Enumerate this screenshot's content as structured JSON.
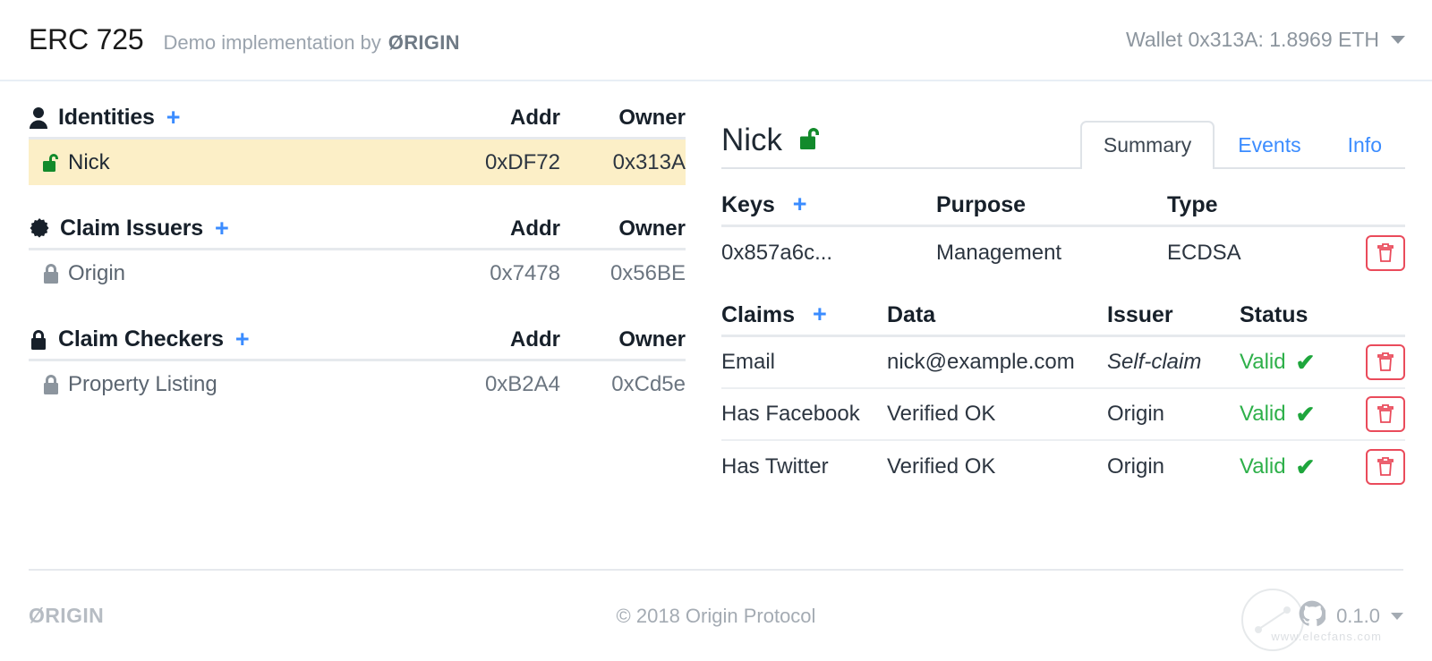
{
  "header": {
    "app_title": "ERC 725",
    "subtitle_prefix": "Demo implementation by",
    "subtitle_brand": "ØRIGIN",
    "wallet_label": "Wallet 0x313A: 1.8969 ETH",
    "caret_icon": "chevron-down-icon"
  },
  "sidebar": {
    "sections": [
      {
        "icon": "person-icon",
        "title": "Identities",
        "add_label": "+",
        "col_addr": "Addr",
        "col_owner": "Owner",
        "rows": [
          {
            "icon": "unlock-icon-green",
            "name": "Nick",
            "addr": "0xDF72",
            "owner": "0x313A",
            "selected": true
          }
        ]
      },
      {
        "icon": "certificate-icon",
        "title": "Claim Issuers",
        "add_label": "+",
        "col_addr": "Addr",
        "col_owner": "Owner",
        "rows": [
          {
            "icon": "lock-icon-gray",
            "name": "Origin",
            "addr": "0x7478",
            "owner": "0x56BE",
            "selected": false
          }
        ]
      },
      {
        "icon": "lock-icon-black",
        "title": "Claim Checkers",
        "add_label": "+",
        "col_addr": "Addr",
        "col_owner": "Owner",
        "rows": [
          {
            "icon": "lock-icon-gray",
            "name": "Property Listing",
            "addr": "0xB2A4",
            "owner": "0xCd5e",
            "selected": false
          }
        ]
      }
    ]
  },
  "detail": {
    "title": "Nick",
    "status_icon": "unlock-icon-green",
    "tabs": [
      {
        "label": "Summary",
        "active": true
      },
      {
        "label": "Events",
        "active": false
      },
      {
        "label": "Info",
        "active": false
      }
    ],
    "keys_table": {
      "title": "Keys",
      "add_label": "+",
      "headers": [
        "Purpose",
        "Type"
      ],
      "rows": [
        {
          "key": "0x857a6c...",
          "purpose": "Management",
          "type": "ECDSA",
          "delete_icon": "trash-icon"
        }
      ]
    },
    "claims_table": {
      "title": "Claims",
      "add_label": "+",
      "headers": [
        "Data",
        "Issuer",
        "Status"
      ],
      "rows": [
        {
          "claim": "Email",
          "data": "nick@example.com",
          "issuer": "Self-claim",
          "issuer_italic": true,
          "status": "Valid",
          "status_icon": "check-icon",
          "delete_icon": "trash-icon"
        },
        {
          "claim": "Has Facebook",
          "data": "Verified OK",
          "issuer": "Origin",
          "issuer_italic": false,
          "status": "Valid",
          "status_icon": "check-icon",
          "delete_icon": "trash-icon"
        },
        {
          "claim": "Has Twitter",
          "data": "Verified OK",
          "issuer": "Origin",
          "issuer_italic": false,
          "status": "Valid",
          "status_icon": "check-icon",
          "delete_icon": "trash-icon"
        }
      ]
    }
  },
  "footer": {
    "logo": "ØRIGIN",
    "copyright": "© 2018  Origin Protocol",
    "version": "0.1.0",
    "github_icon": "github-icon",
    "caret_icon": "chevron-down-icon",
    "watermark_text": "www.elecfans.com"
  },
  "colors": {
    "accent_blue": "#3b8cff",
    "selected_row": "#fcefc7",
    "valid_green": "#2eb04a",
    "unlock_green": "#128a2b",
    "danger_red": "#ea4b5b",
    "muted_gray": "#8c959e"
  }
}
